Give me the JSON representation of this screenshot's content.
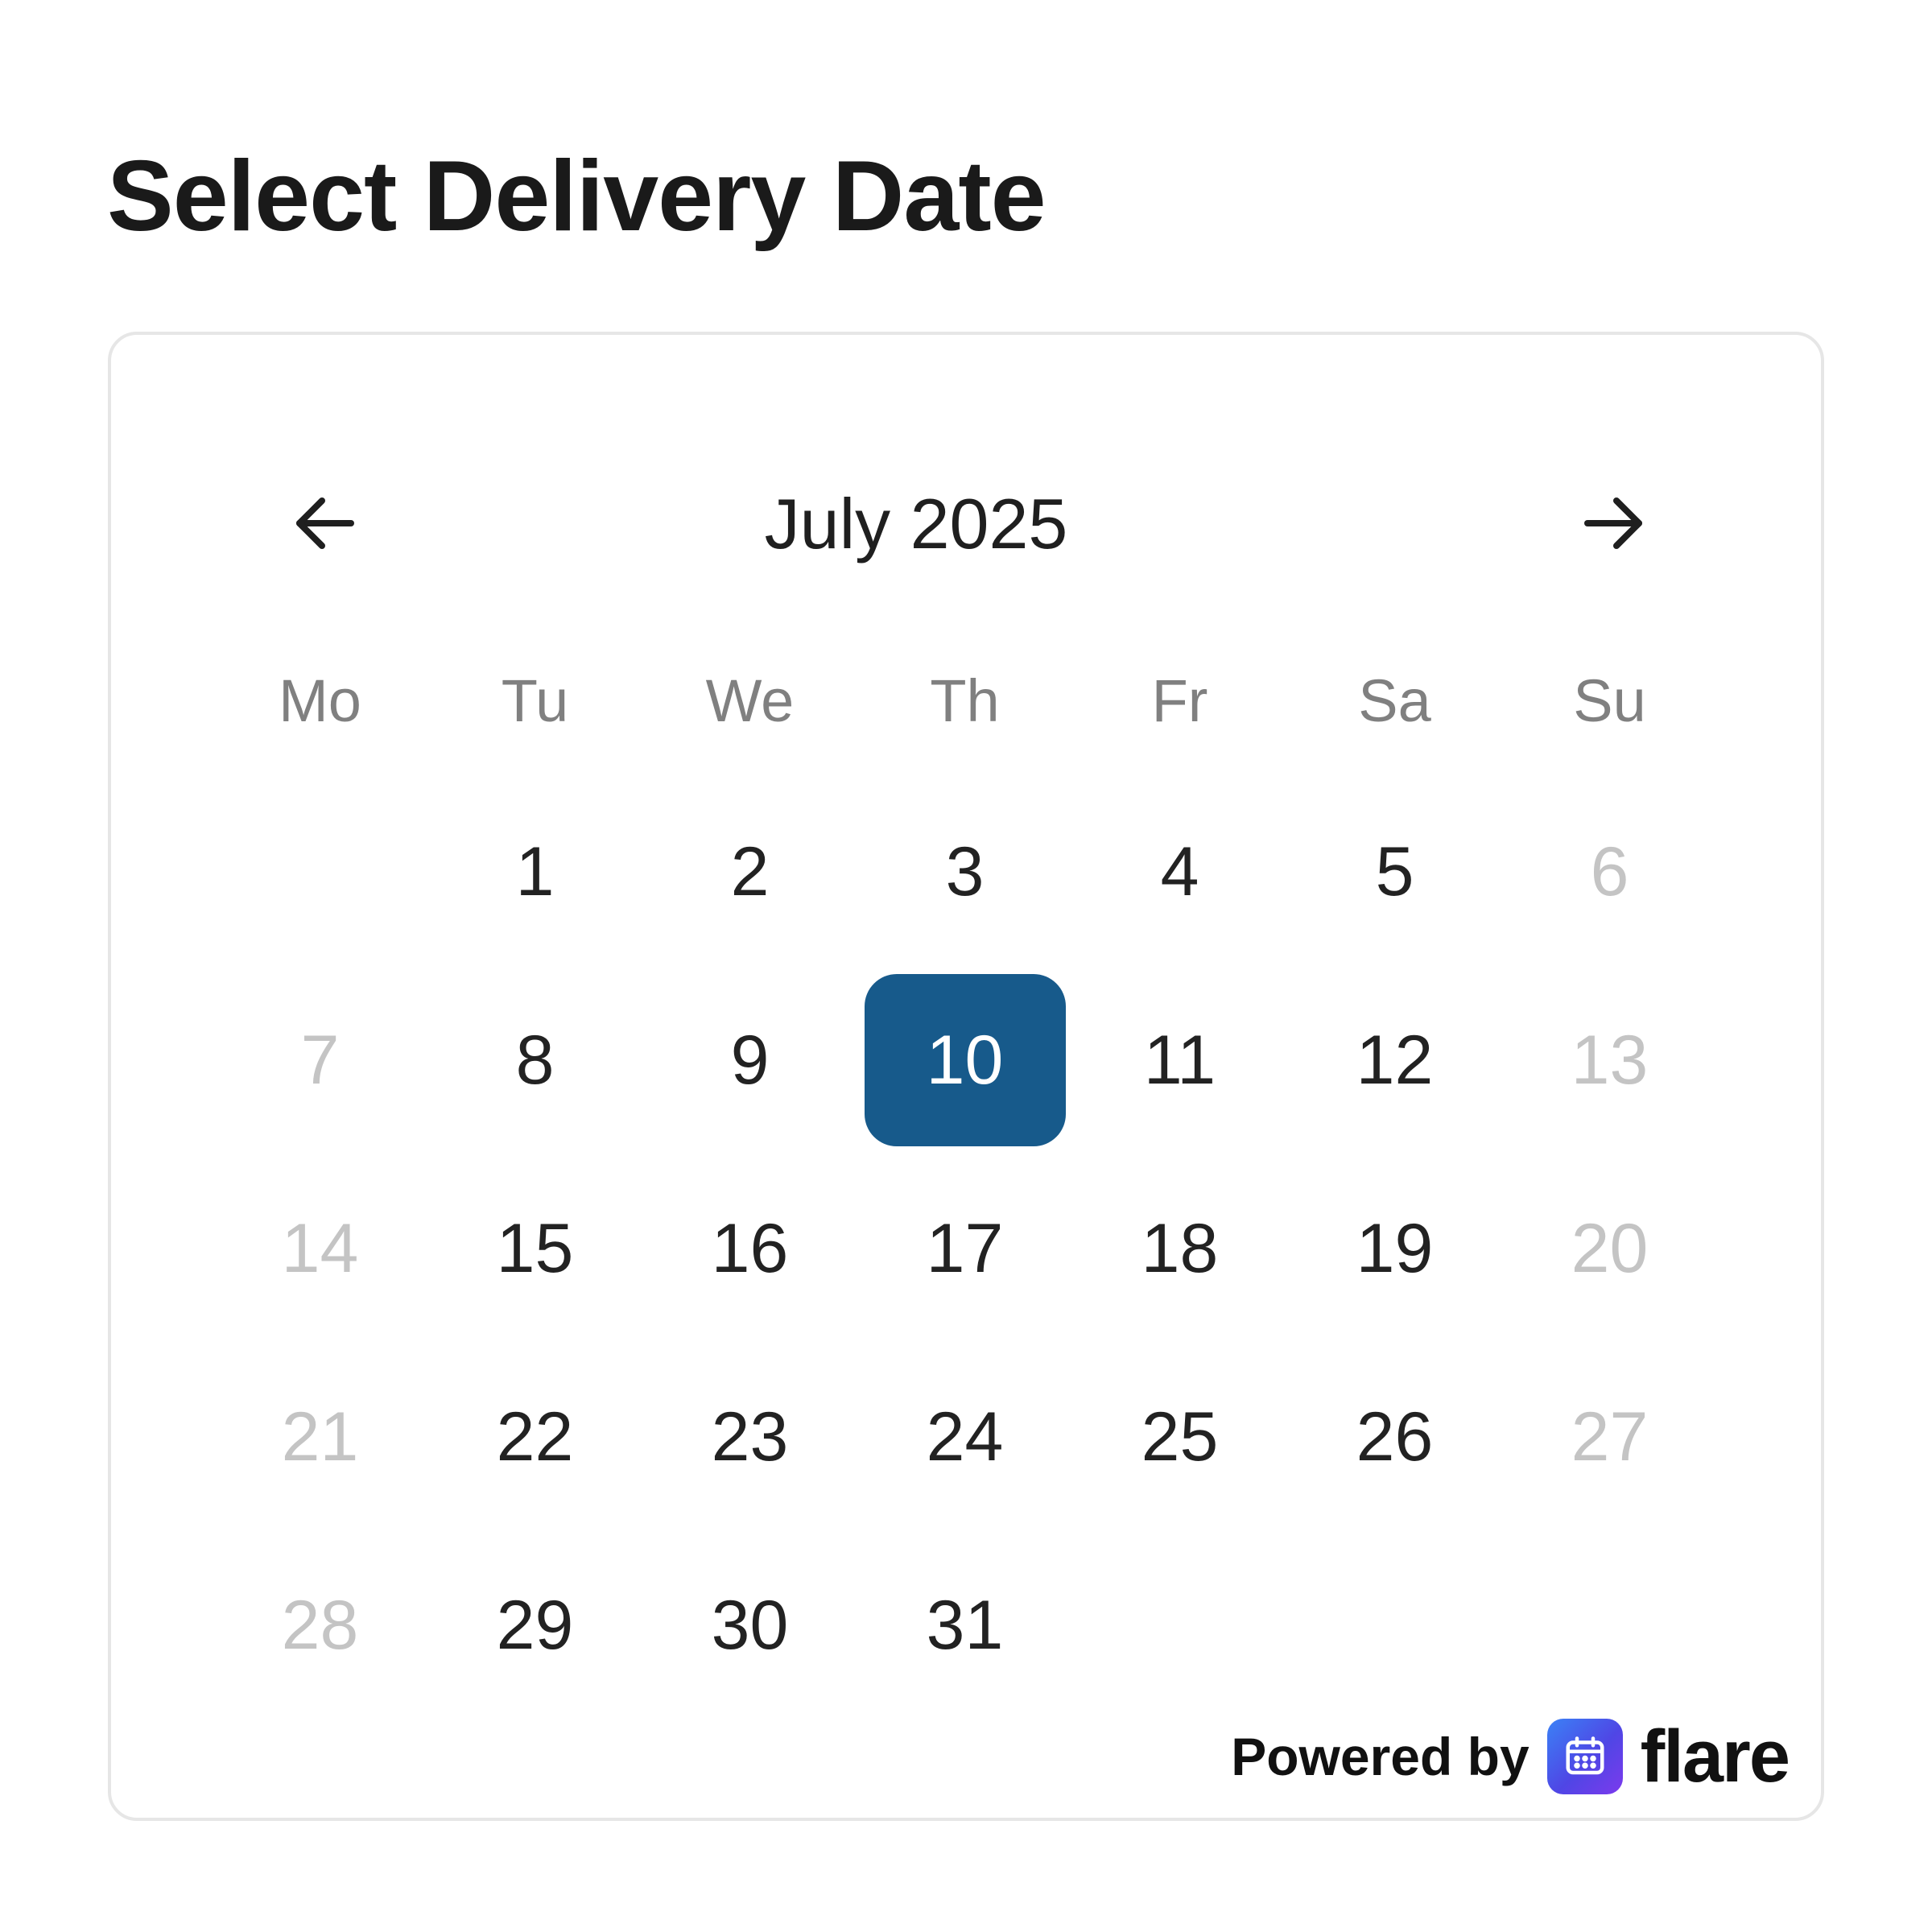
{
  "page": {
    "title": "Select Delivery Date"
  },
  "calendar": {
    "month_label": "July 2025",
    "prev_icon": "arrow-left-icon",
    "next_icon": "arrow-right-icon",
    "weekdays": [
      "Mo",
      "Tu",
      "We",
      "Th",
      "Fr",
      "Sa",
      "Su"
    ],
    "selected_day": "10",
    "selected_color": "#175a8b",
    "disabled_color": "#c4c4c4",
    "weeks": [
      [
        {
          "label": "",
          "state": "empty"
        },
        {
          "label": "1",
          "state": "available"
        },
        {
          "label": "2",
          "state": "available"
        },
        {
          "label": "3",
          "state": "available"
        },
        {
          "label": "4",
          "state": "available"
        },
        {
          "label": "5",
          "state": "available"
        },
        {
          "label": "6",
          "state": "disabled"
        }
      ],
      [
        {
          "label": "7",
          "state": "disabled"
        },
        {
          "label": "8",
          "state": "available"
        },
        {
          "label": "9",
          "state": "available"
        },
        {
          "label": "10",
          "state": "selected"
        },
        {
          "label": "11",
          "state": "available"
        },
        {
          "label": "12",
          "state": "available"
        },
        {
          "label": "13",
          "state": "disabled"
        }
      ],
      [
        {
          "label": "14",
          "state": "disabled"
        },
        {
          "label": "15",
          "state": "available"
        },
        {
          "label": "16",
          "state": "available"
        },
        {
          "label": "17",
          "state": "available"
        },
        {
          "label": "18",
          "state": "available"
        },
        {
          "label": "19",
          "state": "available"
        },
        {
          "label": "20",
          "state": "disabled"
        }
      ],
      [
        {
          "label": "21",
          "state": "disabled"
        },
        {
          "label": "22",
          "state": "available"
        },
        {
          "label": "23",
          "state": "available"
        },
        {
          "label": "24",
          "state": "available"
        },
        {
          "label": "25",
          "state": "available"
        },
        {
          "label": "26",
          "state": "available"
        },
        {
          "label": "27",
          "state": "disabled"
        }
      ],
      [
        {
          "label": "28",
          "state": "disabled"
        },
        {
          "label": "29",
          "state": "available"
        },
        {
          "label": "30",
          "state": "available"
        },
        {
          "label": "31",
          "state": "available"
        },
        {
          "label": "",
          "state": "empty"
        },
        {
          "label": "",
          "state": "empty"
        },
        {
          "label": "",
          "state": "empty"
        }
      ]
    ]
  },
  "footer": {
    "powered_by": "Powered by",
    "logo_icon": "calendar-icon",
    "brand_name": "flare"
  }
}
